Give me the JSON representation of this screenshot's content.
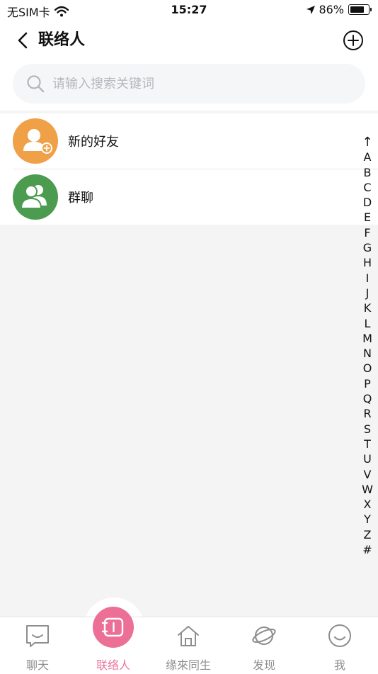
{
  "status_bar": {
    "carrier": "无SIM卡",
    "time": "15:27",
    "battery_pct": "86%",
    "battery_level": 0.86
  },
  "nav": {
    "title": "联络人"
  },
  "search": {
    "placeholder": "请输入搜索关键词"
  },
  "contacts": [
    {
      "name": "新的好友",
      "icon": "user-add-icon",
      "color": "#f0a047"
    },
    {
      "name": "群聊",
      "icon": "group-icon",
      "color": "#4c9c4f"
    }
  ],
  "alpha_index": [
    "↑",
    "A",
    "B",
    "C",
    "D",
    "E",
    "F",
    "G",
    "H",
    "I",
    "J",
    "K",
    "L",
    "M",
    "N",
    "O",
    "P",
    "Q",
    "R",
    "S",
    "T",
    "U",
    "V",
    "W",
    "X",
    "Y",
    "Z",
    "#"
  ],
  "tabs": [
    {
      "label": "聊天",
      "icon": "chat-icon"
    },
    {
      "label": "联络人",
      "icon": "contacts-icon",
      "active": true
    },
    {
      "label": "缘來同生",
      "icon": "house-icon"
    },
    {
      "label": "发现",
      "icon": "planet-icon"
    },
    {
      "label": "我",
      "icon": "smile-icon"
    }
  ],
  "colors": {
    "accent": "#ec6f96",
    "accent_text": "#e9779b",
    "inactive_tab": "#8d8d8d"
  }
}
